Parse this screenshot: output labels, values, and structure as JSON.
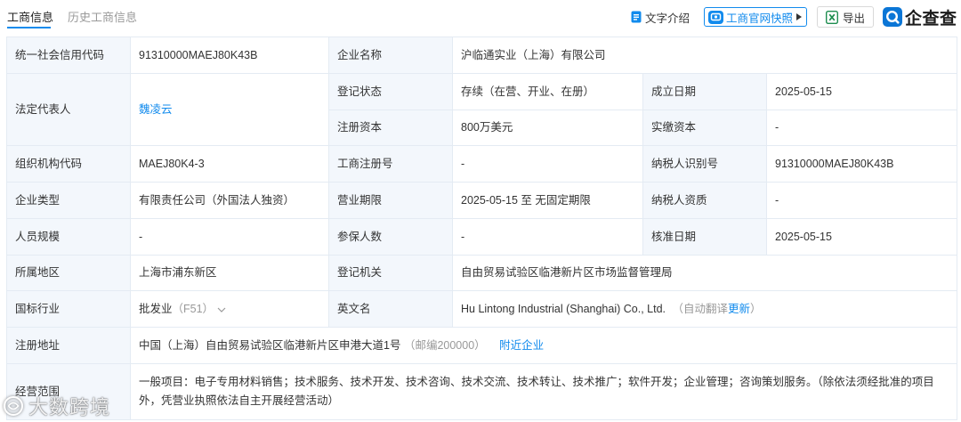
{
  "tabs": [
    {
      "label": "工商信息",
      "active": true
    },
    {
      "label": "历史工商信息",
      "active": false
    }
  ],
  "toolbar": {
    "text_intro": {
      "label": "文字介绍",
      "icon": "document-icon"
    },
    "snapshot": {
      "label": "工商官网快照",
      "icon": "snapshot-icon"
    },
    "export": {
      "label": "导出",
      "icon": "excel-icon"
    },
    "logo": {
      "text": "企查查",
      "icon": "qichacha-logo-icon"
    }
  },
  "info": {
    "credit_code": {
      "label": "统一社会信用代码",
      "value": "91310000MAEJ80K43B"
    },
    "company_name": {
      "label": "企业名称",
      "value": "沪临通实业（上海）有限公司"
    },
    "legal_rep": {
      "label": "法定代表人",
      "value": "魏凌云"
    },
    "reg_status": {
      "label": "登记状态",
      "value": "存续（在营、开业、在册）"
    },
    "established": {
      "label": "成立日期",
      "value": "2025-05-15"
    },
    "reg_capital": {
      "label": "注册资本",
      "value": "800万美元"
    },
    "paid_capital": {
      "label": "实缴资本",
      "value": "-"
    },
    "org_code": {
      "label": "组织机构代码",
      "value": "MAEJ80K4-3"
    },
    "reg_number": {
      "label": "工商注册号",
      "value": "-"
    },
    "taxpayer_id": {
      "label": "纳税人识别号",
      "value": "91310000MAEJ80K43B"
    },
    "company_type": {
      "label": "企业类型",
      "value": "有限责任公司（外国法人独资）"
    },
    "business_term": {
      "label": "营业期限",
      "value": "2025-05-15 至 无固定期限"
    },
    "taxpayer_qualification": {
      "label": "纳税人资质",
      "value": "-"
    },
    "staff_size": {
      "label": "人员规模",
      "value": "-"
    },
    "insured_count": {
      "label": "参保人数",
      "value": "-"
    },
    "approval_date": {
      "label": "核准日期",
      "value": "2025-05-15"
    },
    "region": {
      "label": "所属地区",
      "value": "上海市浦东新区"
    },
    "reg_authority": {
      "label": "登记机关",
      "value": "自由贸易试验区临港新片区市场监督管理局"
    },
    "industry": {
      "label": "国标行业",
      "value": "批发业",
      "code": "（F51）"
    },
    "english_name": {
      "label": "英文名",
      "value": "Hu Lintong Industrial (Shanghai) Co., Ltd.",
      "note_prefix": "（自动翻译",
      "note_link": "更新",
      "note_suffix": "）"
    },
    "address": {
      "label": "注册地址",
      "value": "中国（上海）自由贸易试验区临港新片区申港大道1号",
      "postcode": "（邮编200000）",
      "nearby_link": "附近企业"
    },
    "business_scope": {
      "label": "经营范围",
      "value": "一般项目：电子专用材料销售；技术服务、技术开发、技术咨询、技术交流、技术转让、技术推广；软件开发；企业管理；咨询策划服务。（除依法须经批准的项目外，凭营业执照依法自主开展经营活动）"
    }
  },
  "watermark": {
    "text": "大数跨境"
  },
  "colors": {
    "link_blue": "#128bed",
    "label_bg": "#f3f7fc",
    "border": "#e4ebf3",
    "text": "#333333",
    "muted": "#999999",
    "excel_green": "#1d8d4f"
  }
}
